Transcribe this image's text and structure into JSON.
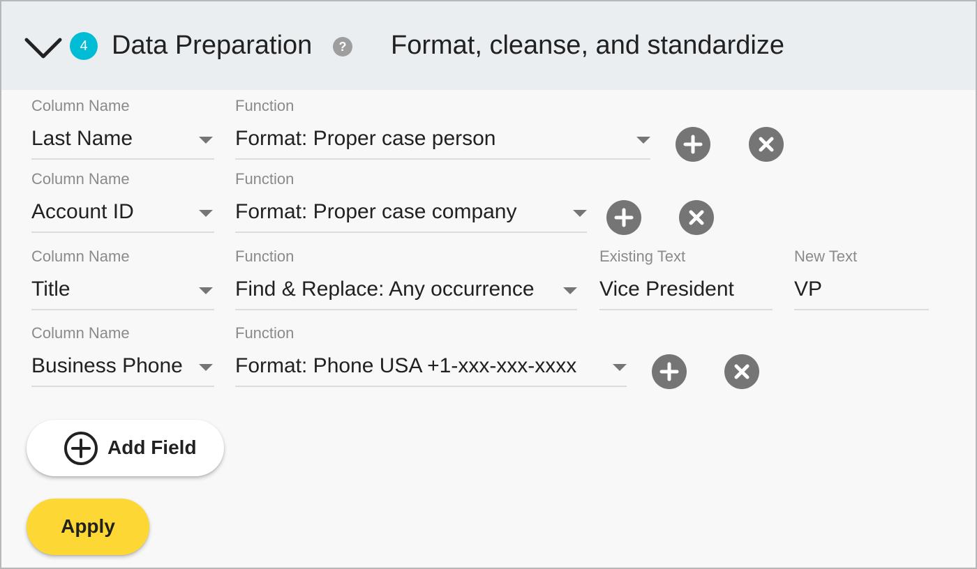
{
  "header": {
    "step_number": "4",
    "title": "Data Preparation",
    "help": "?",
    "subtitle": "Format, cleanse, and standardize"
  },
  "rows": [
    {
      "column_label": "Column Name",
      "column_value": "Last Name",
      "function_label": "Function",
      "function_value": "Format: Proper case person"
    },
    {
      "column_label": "Column Name",
      "column_value": "Account ID",
      "function_label": "Function",
      "function_value": "Format: Proper case company"
    },
    {
      "column_label": "Column Name",
      "column_value": "Title",
      "function_label": "Function",
      "function_value": "Find & Replace: Any occurrence",
      "existing_label": "Existing Text",
      "existing_value": "Vice President",
      "new_label": "New Text",
      "new_value": "VP"
    },
    {
      "column_label": "Column Name",
      "column_value": "Business Phone",
      "function_label": "Function",
      "function_value": "Format: Phone USA +1-xxx-xxx-xxxx"
    }
  ],
  "actions": {
    "add_field": "Add Field",
    "apply": "Apply"
  },
  "colors": {
    "accent": "#00bcd4",
    "apply": "#fdd835",
    "icon_gray": "#757575",
    "header_bg": "#ebeef0"
  }
}
